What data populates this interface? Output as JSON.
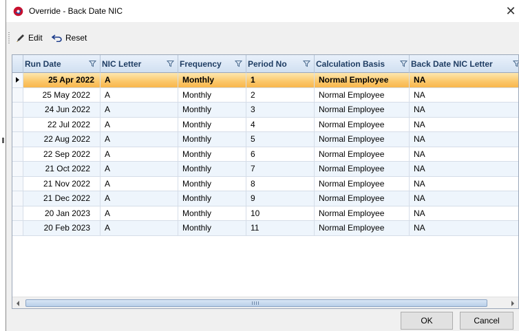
{
  "window": {
    "title": "Override - Back Date NIC"
  },
  "toolbar": {
    "edit_label": "Edit",
    "reset_label": "Reset"
  },
  "grid": {
    "columns": [
      "Run Date",
      "NIC Letter",
      "Frequency",
      "Period No",
      "Calculation Basis",
      "Back Date NIC Letter"
    ],
    "rows": [
      [
        "25 Apr 2022",
        "A",
        "Monthly",
        "1",
        "Normal Employee",
        "NA"
      ],
      [
        "25 May 2022",
        "A",
        "Monthly",
        "2",
        "Normal Employee",
        "NA"
      ],
      [
        "24 Jun 2022",
        "A",
        "Monthly",
        "3",
        "Normal Employee",
        "NA"
      ],
      [
        "22 Jul 2022",
        "A",
        "Monthly",
        "4",
        "Normal Employee",
        "NA"
      ],
      [
        "22 Aug 2022",
        "A",
        "Monthly",
        "5",
        "Normal Employee",
        "NA"
      ],
      [
        "22 Sep 2022",
        "A",
        "Monthly",
        "6",
        "Normal Employee",
        "NA"
      ],
      [
        "21 Oct 2022",
        "A",
        "Monthly",
        "7",
        "Normal Employee",
        "NA"
      ],
      [
        "21 Nov 2022",
        "A",
        "Monthly",
        "8",
        "Normal Employee",
        "NA"
      ],
      [
        "21 Dec 2022",
        "A",
        "Monthly",
        "9",
        "Normal Employee",
        "NA"
      ],
      [
        "20 Jan 2023",
        "A",
        "Monthly",
        "10",
        "Normal Employee",
        "NA"
      ],
      [
        "20 Feb 2023",
        "A",
        "Monthly",
        "11",
        "Normal Employee",
        "NA"
      ]
    ],
    "selected_row": 0
  },
  "buttons": {
    "ok_label": "OK",
    "cancel_label": "Cancel"
  },
  "icons": {
    "app": "app-logo-icon",
    "edit": "pencil-icon",
    "reset": "undo-arrow-icon",
    "filter": "filter-funnel-icon",
    "close": "close-icon",
    "row_indicator": "row-pointer-icon"
  },
  "colors": {
    "selected_row": "#fbc86b",
    "alt_row": "#eef5fc",
    "header_text": "#1f3d63",
    "header_bg": "#d1e0f1"
  }
}
